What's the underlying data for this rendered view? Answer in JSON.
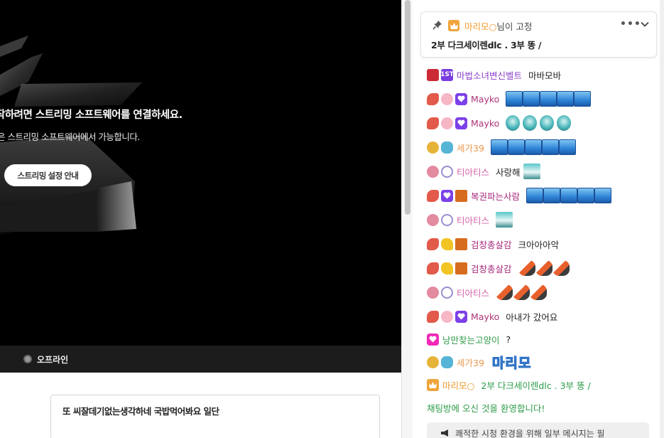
{
  "player": {
    "connect_title": "작하려면 스트리밍 소프트웨어를 연결하세요.",
    "connect_sub": "은 스트리밍 소프트웨어에서 가능합니다.",
    "setup_button": "스트리밍 설정 안내",
    "status": "오프라인"
  },
  "broadcast_notice": "또 씨잘데기없는생각하네 국밥먹어봐요 일단",
  "pinned": {
    "name": "마리모○",
    "suffix": "님이 고정",
    "message": "2부 다크세이렌dlc . 3부 똥 /",
    "more": "•••"
  },
  "chat": [
    {
      "nick": "마법소녀변신벨트",
      "msg": "마바모바"
    },
    {
      "nick": "Mayko",
      "msg": ""
    },
    {
      "nick": "Mayko",
      "msg": ""
    },
    {
      "nick": "세가39",
      "msg": ""
    },
    {
      "nick": "티아티스",
      "msg": "사랑해"
    },
    {
      "nick": "복권파는사람",
      "msg": ""
    },
    {
      "nick": "티아티스",
      "msg": ""
    },
    {
      "nick": "검창총살감",
      "msg": "크아아아악"
    },
    {
      "nick": "검창총살감",
      "msg": ""
    },
    {
      "nick": "티아티스",
      "msg": ""
    },
    {
      "nick": "Mayko",
      "msg": "아내가 갔어요"
    },
    {
      "nick": "낭만찾는고양이",
      "msg": "?"
    },
    {
      "nick": "세가39",
      "msg": "",
      "emote_word": "마리모"
    },
    {
      "nick": "마리모○",
      "msg": "2부 다크세이렌dlc . 3부 똥 /"
    }
  ],
  "welcome": "채팅방에 오신 것을 환영합니다!",
  "footer_notice": "쾌적한 시청 환경을 위해 일부 메시지는 필",
  "badge_text": {
    "first": "1ST"
  },
  "colors": {
    "accent_orange": "#f0a43a",
    "welcome_green": "#2c9b48"
  }
}
